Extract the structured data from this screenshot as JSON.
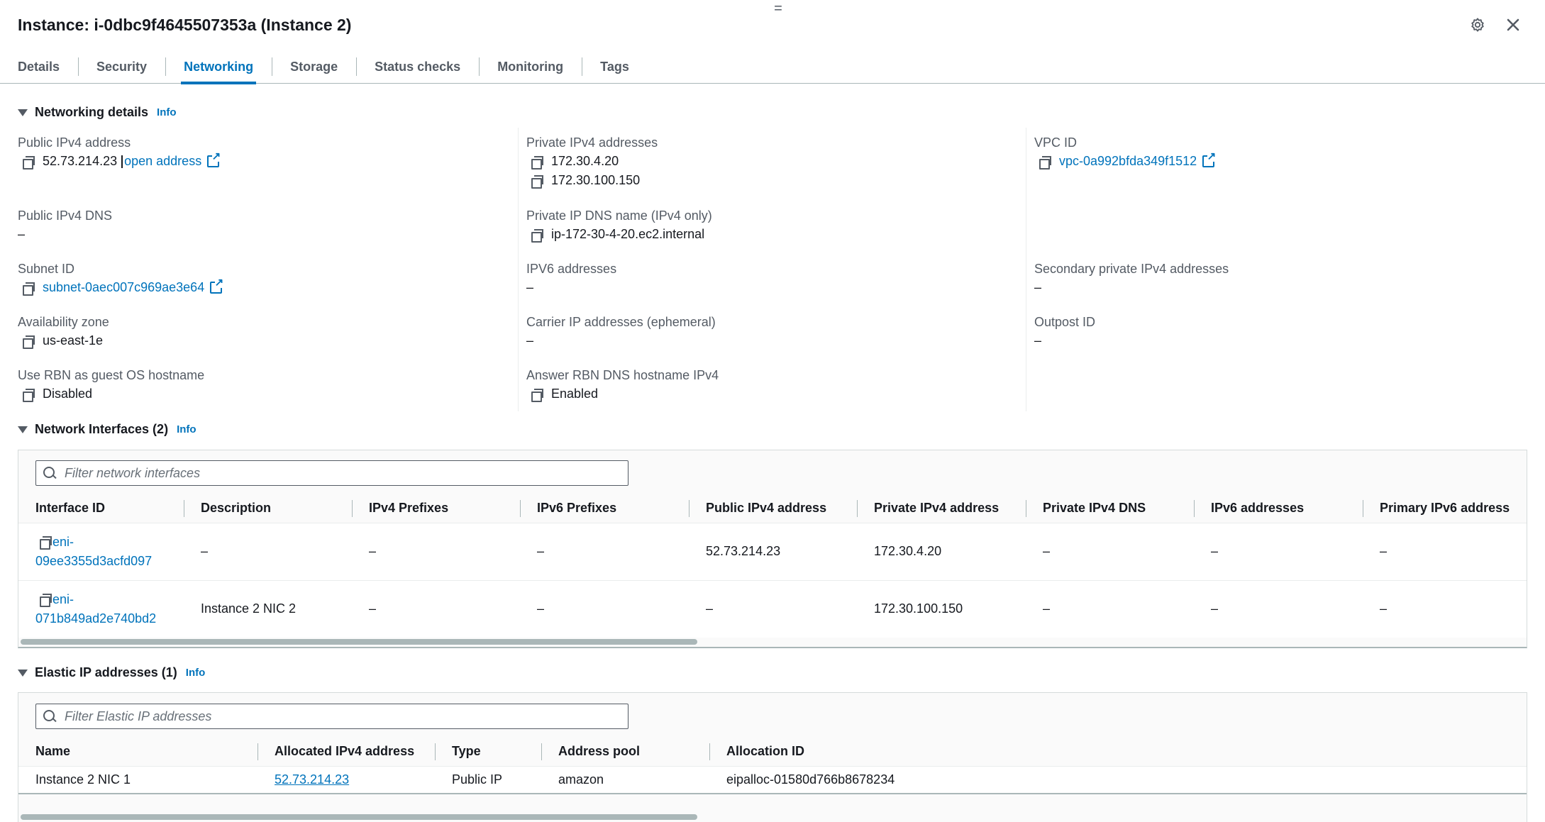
{
  "header": {
    "title": "Instance: i-0dbc9f4645507353a (Instance 2)",
    "drag_glyph": "="
  },
  "tabs": [
    {
      "label": "Details"
    },
    {
      "label": "Security"
    },
    {
      "label": "Networking",
      "active": true
    },
    {
      "label": "Storage"
    },
    {
      "label": "Status checks"
    },
    {
      "label": "Monitoring"
    },
    {
      "label": "Tags"
    }
  ],
  "networking_details": {
    "title": "Networking details",
    "info": "Info",
    "public_ipv4": {
      "label": "Public IPv4 address",
      "value": "52.73.214.23",
      "link": "open address"
    },
    "public_dns": {
      "label": "Public IPv4 DNS",
      "value": "–"
    },
    "subnet": {
      "label": "Subnet ID",
      "value": "subnet-0aec007c969ae3e64"
    },
    "az": {
      "label": "Availability zone",
      "value": "us-east-1e"
    },
    "rbn_hostname": {
      "label": "Use RBN as guest OS hostname",
      "value": "Disabled"
    },
    "private_ipv4": {
      "label": "Private IPv4 addresses",
      "values": [
        "172.30.4.20",
        "172.30.100.150"
      ]
    },
    "private_dns": {
      "label": "Private IP DNS name (IPv4 only)",
      "value": "ip-172-30-4-20.ec2.internal"
    },
    "ipv6": {
      "label": "IPV6 addresses",
      "value": "–"
    },
    "carrier_ip": {
      "label": "Carrier IP addresses (ephemeral)",
      "value": "–"
    },
    "answer_rbn": {
      "label": "Answer RBN DNS hostname IPv4",
      "value": "Enabled"
    },
    "vpc": {
      "label": "VPC ID",
      "value": "vpc-0a992bfda349f1512"
    },
    "secondary_private": {
      "label": "Secondary private IPv4 addresses",
      "value": "–"
    },
    "outpost": {
      "label": "Outpost ID",
      "value": "–"
    }
  },
  "network_interfaces": {
    "title": "Network Interfaces (2)",
    "info": "Info",
    "filter_placeholder": "Filter network interfaces",
    "columns": [
      "Interface ID",
      "Description",
      "IPv4 Prefixes",
      "IPv6 Prefixes",
      "Public IPv4 address",
      "Private IPv4 address",
      "Private IPv4 DNS",
      "IPv6 addresses",
      "Primary IPv6 address"
    ],
    "rows": [
      {
        "id_line1": "eni-",
        "id_line2": "09ee3355d3acfd097",
        "description": "–",
        "ipv4_prefixes": "–",
        "ipv6_prefixes": "–",
        "public_ipv4": "52.73.214.23",
        "private_ipv4": "172.30.4.20",
        "private_dns": "–",
        "ipv6": "–",
        "primary_ipv6": "–"
      },
      {
        "id_line1": "eni-",
        "id_line2": "071b849ad2e740bd2",
        "description": "Instance 2 NIC 2",
        "ipv4_prefixes": "–",
        "ipv6_prefixes": "–",
        "public_ipv4": "–",
        "private_ipv4": "172.30.100.150",
        "private_dns": "–",
        "ipv6": "–",
        "primary_ipv6": "–"
      }
    ]
  },
  "elastic_ips": {
    "title": "Elastic IP addresses (1)",
    "info": "Info",
    "filter_placeholder": "Filter Elastic IP addresses",
    "columns": [
      "Name",
      "Allocated IPv4 address",
      "Type",
      "Address pool",
      "Allocation ID"
    ],
    "rows": [
      {
        "name": "Instance 2 NIC 1",
        "address": "52.73.214.23",
        "type": "Public IP",
        "pool": "amazon",
        "allocation_id": "eipalloc-01580d766b8678234"
      }
    ]
  }
}
